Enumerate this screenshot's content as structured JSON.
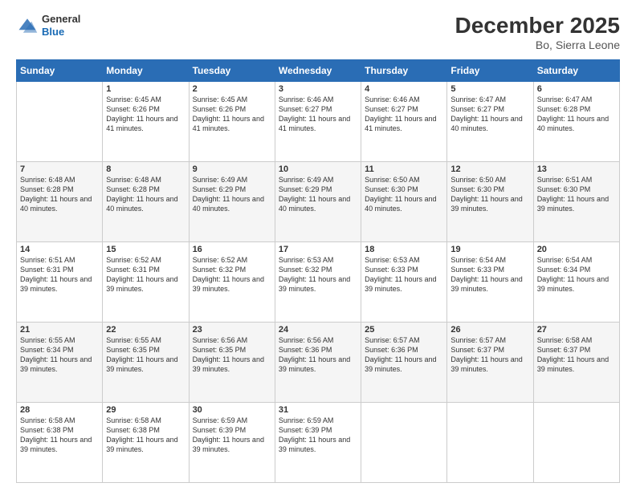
{
  "header": {
    "logo": {
      "line1": "General",
      "line2": "Blue"
    },
    "title": "December 2025",
    "subtitle": "Bo, Sierra Leone"
  },
  "weekdays": [
    "Sunday",
    "Monday",
    "Tuesday",
    "Wednesday",
    "Thursday",
    "Friday",
    "Saturday"
  ],
  "weeks": [
    [
      {
        "day": "",
        "sunrise": "",
        "sunset": "",
        "daylight": ""
      },
      {
        "day": "1",
        "sunrise": "Sunrise: 6:45 AM",
        "sunset": "Sunset: 6:26 PM",
        "daylight": "Daylight: 11 hours and 41 minutes."
      },
      {
        "day": "2",
        "sunrise": "Sunrise: 6:45 AM",
        "sunset": "Sunset: 6:26 PM",
        "daylight": "Daylight: 11 hours and 41 minutes."
      },
      {
        "day": "3",
        "sunrise": "Sunrise: 6:46 AM",
        "sunset": "Sunset: 6:27 PM",
        "daylight": "Daylight: 11 hours and 41 minutes."
      },
      {
        "day": "4",
        "sunrise": "Sunrise: 6:46 AM",
        "sunset": "Sunset: 6:27 PM",
        "daylight": "Daylight: 11 hours and 41 minutes."
      },
      {
        "day": "5",
        "sunrise": "Sunrise: 6:47 AM",
        "sunset": "Sunset: 6:27 PM",
        "daylight": "Daylight: 11 hours and 40 minutes."
      },
      {
        "day": "6",
        "sunrise": "Sunrise: 6:47 AM",
        "sunset": "Sunset: 6:28 PM",
        "daylight": "Daylight: 11 hours and 40 minutes."
      }
    ],
    [
      {
        "day": "7",
        "sunrise": "Sunrise: 6:48 AM",
        "sunset": "Sunset: 6:28 PM",
        "daylight": "Daylight: 11 hours and 40 minutes."
      },
      {
        "day": "8",
        "sunrise": "Sunrise: 6:48 AM",
        "sunset": "Sunset: 6:28 PM",
        "daylight": "Daylight: 11 hours and 40 minutes."
      },
      {
        "day": "9",
        "sunrise": "Sunrise: 6:49 AM",
        "sunset": "Sunset: 6:29 PM",
        "daylight": "Daylight: 11 hours and 40 minutes."
      },
      {
        "day": "10",
        "sunrise": "Sunrise: 6:49 AM",
        "sunset": "Sunset: 6:29 PM",
        "daylight": "Daylight: 11 hours and 40 minutes."
      },
      {
        "day": "11",
        "sunrise": "Sunrise: 6:50 AM",
        "sunset": "Sunset: 6:30 PM",
        "daylight": "Daylight: 11 hours and 40 minutes."
      },
      {
        "day": "12",
        "sunrise": "Sunrise: 6:50 AM",
        "sunset": "Sunset: 6:30 PM",
        "daylight": "Daylight: 11 hours and 39 minutes."
      },
      {
        "day": "13",
        "sunrise": "Sunrise: 6:51 AM",
        "sunset": "Sunset: 6:30 PM",
        "daylight": "Daylight: 11 hours and 39 minutes."
      }
    ],
    [
      {
        "day": "14",
        "sunrise": "Sunrise: 6:51 AM",
        "sunset": "Sunset: 6:31 PM",
        "daylight": "Daylight: 11 hours and 39 minutes."
      },
      {
        "day": "15",
        "sunrise": "Sunrise: 6:52 AM",
        "sunset": "Sunset: 6:31 PM",
        "daylight": "Daylight: 11 hours and 39 minutes."
      },
      {
        "day": "16",
        "sunrise": "Sunrise: 6:52 AM",
        "sunset": "Sunset: 6:32 PM",
        "daylight": "Daylight: 11 hours and 39 minutes."
      },
      {
        "day": "17",
        "sunrise": "Sunrise: 6:53 AM",
        "sunset": "Sunset: 6:32 PM",
        "daylight": "Daylight: 11 hours and 39 minutes."
      },
      {
        "day": "18",
        "sunrise": "Sunrise: 6:53 AM",
        "sunset": "Sunset: 6:33 PM",
        "daylight": "Daylight: 11 hours and 39 minutes."
      },
      {
        "day": "19",
        "sunrise": "Sunrise: 6:54 AM",
        "sunset": "Sunset: 6:33 PM",
        "daylight": "Daylight: 11 hours and 39 minutes."
      },
      {
        "day": "20",
        "sunrise": "Sunrise: 6:54 AM",
        "sunset": "Sunset: 6:34 PM",
        "daylight": "Daylight: 11 hours and 39 minutes."
      }
    ],
    [
      {
        "day": "21",
        "sunrise": "Sunrise: 6:55 AM",
        "sunset": "Sunset: 6:34 PM",
        "daylight": "Daylight: 11 hours and 39 minutes."
      },
      {
        "day": "22",
        "sunrise": "Sunrise: 6:55 AM",
        "sunset": "Sunset: 6:35 PM",
        "daylight": "Daylight: 11 hours and 39 minutes."
      },
      {
        "day": "23",
        "sunrise": "Sunrise: 6:56 AM",
        "sunset": "Sunset: 6:35 PM",
        "daylight": "Daylight: 11 hours and 39 minutes."
      },
      {
        "day": "24",
        "sunrise": "Sunrise: 6:56 AM",
        "sunset": "Sunset: 6:36 PM",
        "daylight": "Daylight: 11 hours and 39 minutes."
      },
      {
        "day": "25",
        "sunrise": "Sunrise: 6:57 AM",
        "sunset": "Sunset: 6:36 PM",
        "daylight": "Daylight: 11 hours and 39 minutes."
      },
      {
        "day": "26",
        "sunrise": "Sunrise: 6:57 AM",
        "sunset": "Sunset: 6:37 PM",
        "daylight": "Daylight: 11 hours and 39 minutes."
      },
      {
        "day": "27",
        "sunrise": "Sunrise: 6:58 AM",
        "sunset": "Sunset: 6:37 PM",
        "daylight": "Daylight: 11 hours and 39 minutes."
      }
    ],
    [
      {
        "day": "28",
        "sunrise": "Sunrise: 6:58 AM",
        "sunset": "Sunset: 6:38 PM",
        "daylight": "Daylight: 11 hours and 39 minutes."
      },
      {
        "day": "29",
        "sunrise": "Sunrise: 6:58 AM",
        "sunset": "Sunset: 6:38 PM",
        "daylight": "Daylight: 11 hours and 39 minutes."
      },
      {
        "day": "30",
        "sunrise": "Sunrise: 6:59 AM",
        "sunset": "Sunset: 6:39 PM",
        "daylight": "Daylight: 11 hours and 39 minutes."
      },
      {
        "day": "31",
        "sunrise": "Sunrise: 6:59 AM",
        "sunset": "Sunset: 6:39 PM",
        "daylight": "Daylight: 11 hours and 39 minutes."
      },
      {
        "day": "",
        "sunrise": "",
        "sunset": "",
        "daylight": ""
      },
      {
        "day": "",
        "sunrise": "",
        "sunset": "",
        "daylight": ""
      },
      {
        "day": "",
        "sunrise": "",
        "sunset": "",
        "daylight": ""
      }
    ]
  ]
}
